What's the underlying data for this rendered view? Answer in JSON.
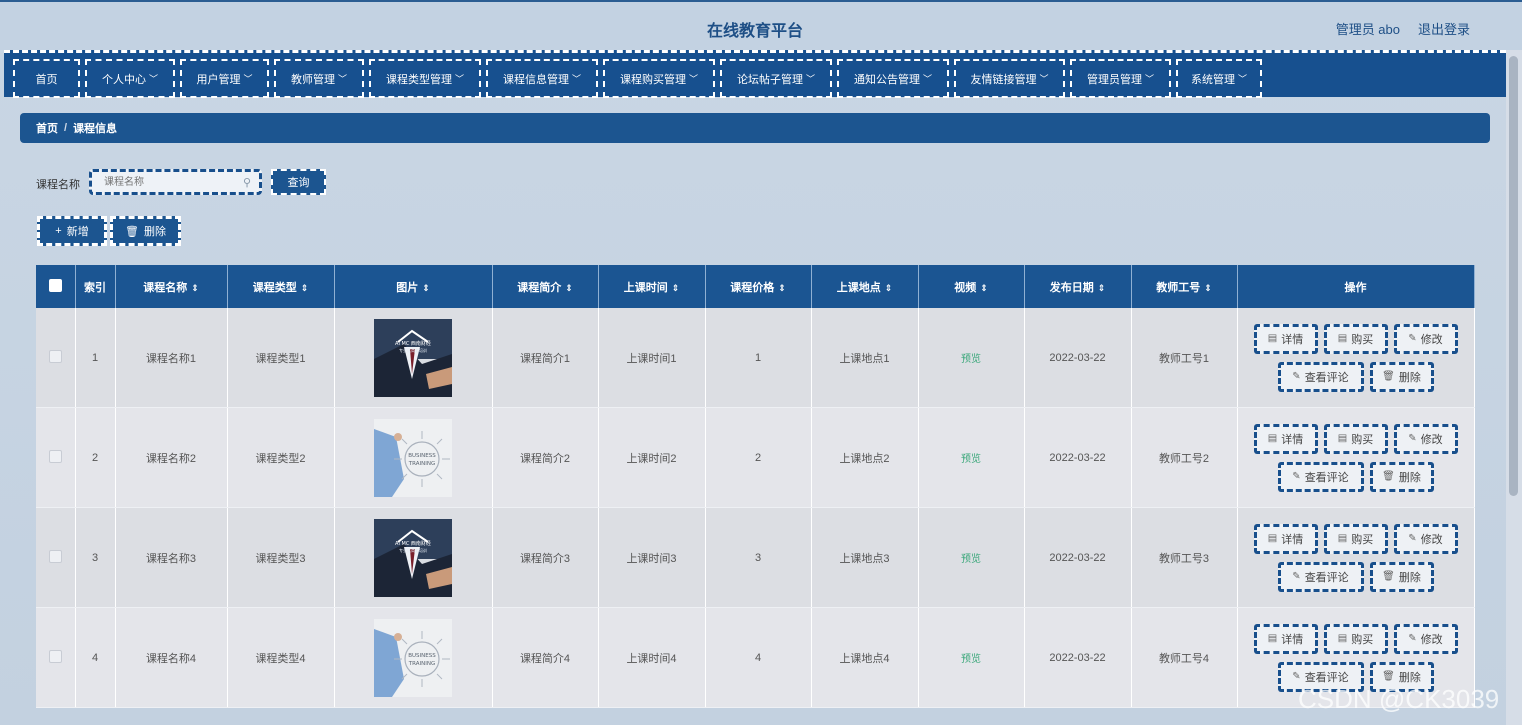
{
  "header": {
    "title": "在线教育平台",
    "admin_label": "管理员 abo",
    "logout": "退出登录"
  },
  "nav": [
    {
      "label": "首页",
      "dropdown": false
    },
    {
      "label": "个人中心",
      "dropdown": true
    },
    {
      "label": "用户管理",
      "dropdown": true
    },
    {
      "label": "教师管理",
      "dropdown": true
    },
    {
      "label": "课程类型管理",
      "dropdown": true
    },
    {
      "label": "课程信息管理",
      "dropdown": true
    },
    {
      "label": "课程购买管理",
      "dropdown": true
    },
    {
      "label": "论坛帖子管理",
      "dropdown": true
    },
    {
      "label": "通知公告管理",
      "dropdown": true
    },
    {
      "label": "友情链接管理",
      "dropdown": true
    },
    {
      "label": "管理员管理",
      "dropdown": true
    },
    {
      "label": "系统管理",
      "dropdown": true
    }
  ],
  "breadcrumb": {
    "home": "首页",
    "separator": "/",
    "current": "课程信息"
  },
  "search": {
    "label": "课程名称",
    "placeholder": "课程名称",
    "button": "查询"
  },
  "actions": {
    "add": "新增",
    "delete": "删除"
  },
  "table": {
    "headers": [
      "索引",
      "课程名称",
      "课程类型",
      "图片",
      "课程简介",
      "上课时间",
      "课程价格",
      "上课地点",
      "视频",
      "发布日期",
      "教师工号",
      "操作"
    ],
    "rows": [
      {
        "index": "1",
        "name": "课程名称1",
        "type": "课程类型1",
        "intro": "课程简介1",
        "time": "上课时间1",
        "price": "1",
        "location": "上课地点1",
        "video": "预览",
        "date": "2022-03-22",
        "teacher": "教师工号1",
        "image": "suit"
      },
      {
        "index": "2",
        "name": "课程名称2",
        "type": "课程类型2",
        "intro": "课程简介2",
        "time": "上课时间2",
        "price": "2",
        "location": "上课地点2",
        "video": "预览",
        "date": "2022-03-22",
        "teacher": "教师工号2",
        "image": "training"
      },
      {
        "index": "3",
        "name": "课程名称3",
        "type": "课程类型3",
        "intro": "课程简介3",
        "time": "上课时间3",
        "price": "3",
        "location": "上课地点3",
        "video": "预览",
        "date": "2022-03-22",
        "teacher": "教师工号3",
        "image": "suit"
      },
      {
        "index": "4",
        "name": "课程名称4",
        "type": "课程类型4",
        "intro": "课程简介4",
        "time": "上课时间4",
        "price": "4",
        "location": "上课地点4",
        "video": "预览",
        "date": "2022-03-22",
        "teacher": "教师工号4",
        "image": "training"
      }
    ],
    "row_buttons": {
      "detail": "详情",
      "buy": "购买",
      "edit": "修改",
      "comments": "查看评论",
      "delete": "删除"
    }
  },
  "image_text": {
    "suit_line1": "AI MC 西南财经",
    "suit_line2": "专业化商务培训",
    "training_line1": "BUSINESS",
    "training_line2": "TRAINING"
  },
  "watermark": "CSDN @CK3039",
  "colors": {
    "primary": "#1b5592",
    "preview": "#3aa77a"
  }
}
